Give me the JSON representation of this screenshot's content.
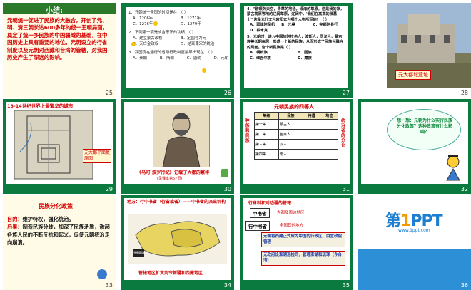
{
  "slides": [
    {
      "num": "25",
      "title": "小结:",
      "body": "元朝统一促进了民族的大融合，开创了元、明、清三朝长达600多年的统一王朝局面，奠定了统一多民族的中国疆域的基础，在中国历史上具有重要的地位。元朝设立的行省制度以及元朝对西藏和台湾的管辖，对我国历史产生了深远的影响。"
    },
    {
      "num": "26",
      "q1": "1．元朝统一全国的时间是在：（  ）",
      "q1a": [
        "A．1206年",
        "B．1271年",
        "C．1276年",
        "D．1279年"
      ],
      "q2": "2．下列哪一项是成吉思汗的功绩：（  ）",
      "q2a": [
        "A．建立蒙古政权",
        "B．定国号为元",
        "C．灭亡金政权",
        "D．结束南宋的统治"
      ],
      "q3": "3．我国现在通行的省级行政制度最早出现在：（  ）",
      "q3a": [
        "A．秦朝",
        "B．隋朝",
        "C．唐朝",
        "D．元朝"
      ]
    },
    {
      "num": "27",
      "q4": "4．\"碧眼的天空，青草的地毯，绿海的草原，这是我的家，蒙古高原等地的辽阔草原，辽阔中，'我们在高高的陵墓上'\"这是元代文人欧阳玄为哪个人物所写的？（  ）",
      "q4a": [
        "A．耶律阿保机",
        "B．元昊",
        "C．完颜阿骨打",
        "D．铁木真"
      ],
      "q5": "5．元朝时，进入中国的阿拉伯人，波斯人，同汉人，蒙古族等长期杂居，形成一个新的民族，从而形成了民族大融合的局面。这个新民族是（  ）",
      "q5a": [
        "A．朝鲜族",
        "B．回族",
        "C．维吾尔族",
        "D．藏族"
      ]
    },
    {
      "num": "28",
      "caption": "元大都城遗址"
    },
    {
      "num": "29",
      "title": "13-14世纪世界上最繁华的城市",
      "caption": "元大都平面复原图"
    },
    {
      "num": "30",
      "caption": "《马可·波罗行纪》记载了大都的繁华",
      "note": "(见课本第57页)"
    },
    {
      "num": "31",
      "title": "元朝民族的四等人",
      "side_left": "种族和民族",
      "side_right": "统治者的分化",
      "headers": [
        "等级",
        "民族",
        "待遇",
        "地位"
      ],
      "rows": [
        [
          "第一等",
          "蒙古人",
          "",
          ""
        ],
        [
          "第二等",
          "色目人",
          "",
          ""
        ],
        [
          "第三等",
          "汉人",
          "",
          ""
        ],
        [
          "第四等",
          "南人",
          "",
          ""
        ]
      ]
    },
    {
      "num": "32",
      "bubble": "想一想：元朝为什么实行民族分化政策？这种政策有什么影响？"
    },
    {
      "num": "33",
      "title": "民族分化政策",
      "p1_label": "目的：",
      "p1": "维护特权，强化统治。",
      "p2_label": "后果：",
      "p2": "制造民族分歧，加深了民族矛盾，激起各族人民的不断反抗和起义，促使元朝统治走向崩溃。"
    },
    {
      "num": "34",
      "top": "地方：行中书省（行省或省）——中书省的派出机构",
      "bottom": "管辖地区扩大到今新疆和西藏地区",
      "label": "元朝疆域"
    },
    {
      "num": "35",
      "title": "行省制和对边疆的管辖",
      "a1": "中书省",
      "a1t": "大都及周边地区",
      "a2": "行中书省",
      "a2t": "全国其他地方",
      "b1": "元朝将西藏正式成为中国的行政区，由宣政院管理",
      "b2": "元政府设澎湖巡检司，管理澎湖和琉球（今台湾）"
    },
    {
      "num": "36",
      "brand_pre": "第",
      "brand_one": "1",
      "brand_post": "PPT",
      "sub": "www.1ppt.com"
    }
  ]
}
